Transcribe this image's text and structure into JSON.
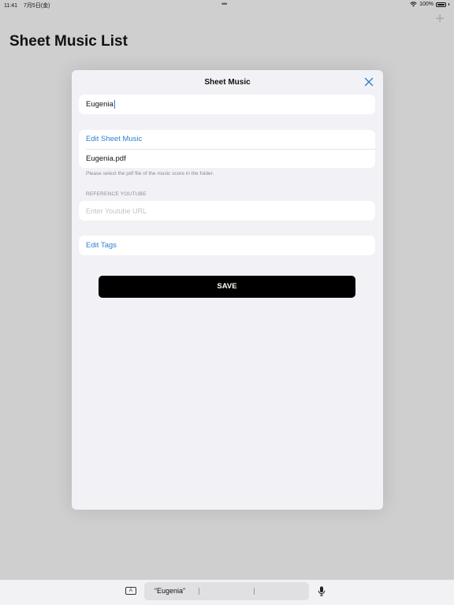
{
  "status_bar": {
    "time": "11:41",
    "date": "7月5日(金)",
    "battery": "100%"
  },
  "header": {
    "title": "Sheet Music List",
    "add_symbol": "+"
  },
  "modal": {
    "title": "Sheet Music",
    "name_value": "Eugenia",
    "edit_sheet_label": "Edit Sheet Music",
    "sheet_file": "Eugenia.pdf",
    "helper_text": "Please select the pdf file of the music score in the folder.",
    "youtube_label": "REFERENCE YOUTUBE",
    "youtube_placeholder": "Enter Youtube URL",
    "edit_tags_label": "Edit Tags",
    "save_label": "SAVE"
  },
  "keyboard_bar": {
    "suggestion": "“Eugenia”"
  },
  "colors": {
    "accent": "#2e7fd1",
    "background": "#cfcfcf",
    "modal_bg": "#f2f2f6",
    "save_bg": "#000000"
  }
}
